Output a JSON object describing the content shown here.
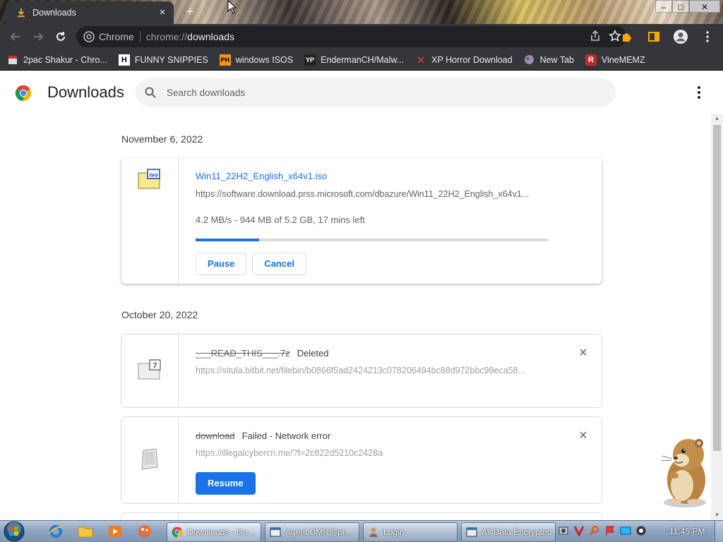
{
  "tab": {
    "title": "Downloads",
    "close": "×",
    "new_tab": "+"
  },
  "window_controls": {
    "minimize": "–",
    "maximize": "□",
    "close": "✕"
  },
  "omnibox": {
    "site_label": "Chrome",
    "url_host": "chrome://",
    "url_path": "downloads"
  },
  "bookmarks": [
    {
      "label": "2pac Shakur - Chro...",
      "icon": "bookmark-favicon-2pac"
    },
    {
      "label": "FUNNY SNIPPIES",
      "icon": "bookmark-favicon-h"
    },
    {
      "label": "windows ISOS",
      "icon": "bookmark-favicon-ph"
    },
    {
      "label": "EndermanCH/Malw...",
      "icon": "bookmark-favicon-yp"
    },
    {
      "label": "XP Horror Download",
      "icon": "bookmark-favicon-x"
    },
    {
      "label": "New Tab",
      "icon": "bookmark-favicon-globe"
    },
    {
      "label": "VineMEMZ",
      "icon": "bookmark-favicon-r"
    }
  ],
  "page": {
    "title": "Downloads",
    "search_placeholder": "Search downloads"
  },
  "groups": [
    {
      "date": "November 6, 2022",
      "items": [
        {
          "filename": "Win11_22H2_English_x64v1.iso",
          "url": "https://software.download.prss.microsoft.com/dbazure/Win11_22H2_English_x64v1...",
          "progress_text": "4.2 MB/s - 944 MB of 5.2 GB, 17 mins left",
          "progress_fraction": 0.18,
          "icon": "iso-file-icon",
          "icon_label": "iso",
          "buttons": [
            "Pause",
            "Cancel"
          ]
        }
      ]
    },
    {
      "date": "October 20, 2022",
      "items": [
        {
          "filename": "___READ_THIS___.7z",
          "status": "Deleted",
          "url": "https://situla.bitbit.net/filebin/b0866f5ad2424213c078206494bc88d972bbc99eca58...",
          "icon": "7z-file-icon",
          "icon_label": "7"
        },
        {
          "filename": "download",
          "status": "Failed - Network error",
          "url": "https://illegalcybercri.me/?f=2c822d5210c2428a",
          "icon": "generic-file-icon",
          "buttons": [
            "Resume"
          ]
        }
      ]
    }
  ],
  "taskbar": {
    "tasks": [
      {
        "label": "Downloads - Go...",
        "icon": "chrome-icon",
        "active": true
      },
      {
        "label": "Agent.DMR@pr...",
        "icon": "window-icon",
        "active": false
      },
      {
        "label": "Login",
        "icon": "user-icon",
        "active": false
      },
      {
        "label": "All Data Encrypted",
        "icon": "window-icon",
        "active": false
      }
    ],
    "clock": "11:45 PM"
  },
  "colors": {
    "accent": "#1a73e8",
    "chrome_dark": "#35363a",
    "omnibox_bg": "#202124"
  }
}
